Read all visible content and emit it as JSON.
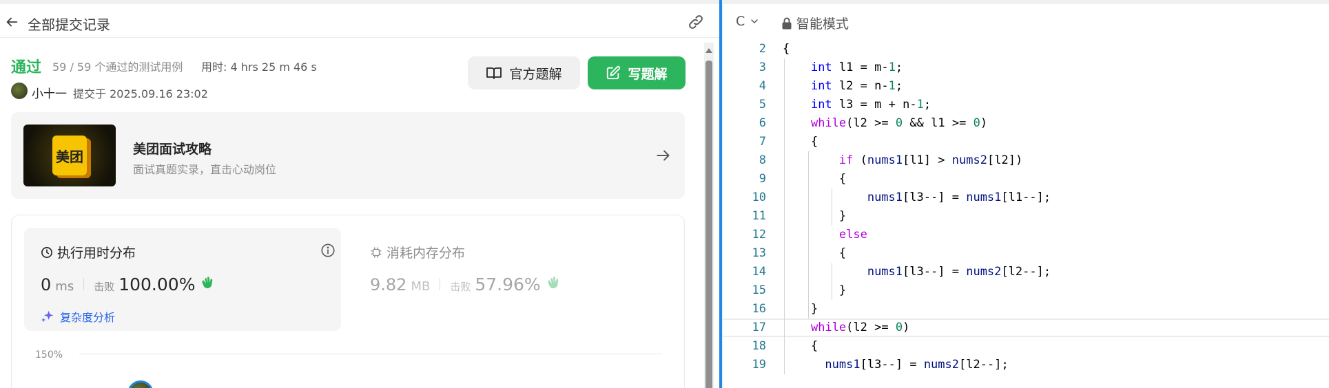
{
  "left_header": {
    "title": "全部提交记录"
  },
  "submission": {
    "status": "通过",
    "cases": "59 / 59 个通过的测试用例",
    "time_label": "用时: 4 hrs 25 m 46 s",
    "author": "小十一",
    "submitted_at": "提交于 2025.09.16 23:02"
  },
  "buttons": {
    "official": "官方题解",
    "write": "写题解"
  },
  "promo": {
    "logo_text": "美团",
    "title": "美团面试攻略",
    "subtitle": "面试真题实录，直击心动岗位"
  },
  "runtime": {
    "title": "执行用时分布",
    "value": "0",
    "unit": "ms",
    "beat_label": "击败",
    "beat_pct": "100.00%",
    "analysis": "复杂度分析"
  },
  "memory": {
    "title": "消耗内存分布",
    "value": "9.82",
    "unit": "MB",
    "beat_label": "击败",
    "beat_pct": "57.96%"
  },
  "chart": {
    "y_tick": "150%"
  },
  "editor_header": {
    "language": "C",
    "mode": "智能模式"
  },
  "code": {
    "current_line": "17",
    "lines": [
      {
        "n": "2",
        "text": "{"
      },
      {
        "n": "3",
        "text": "    int l1 = m-1;"
      },
      {
        "n": "4",
        "text": "    int l2 = n-1;"
      },
      {
        "n": "5",
        "text": "    int l3 = m + n-1;"
      },
      {
        "n": "6",
        "text": "    while(l2 >= 0 && l1 >= 0)"
      },
      {
        "n": "7",
        "text": "    {"
      },
      {
        "n": "8",
        "text": "        if (nums1[l1] > nums2[l2])"
      },
      {
        "n": "9",
        "text": "        {"
      },
      {
        "n": "10",
        "text": "            nums1[l3--] = nums1[l1--];"
      },
      {
        "n": "11",
        "text": "        }"
      },
      {
        "n": "12",
        "text": "        else"
      },
      {
        "n": "13",
        "text": "        {"
      },
      {
        "n": "14",
        "text": "            nums1[l3--] = nums2[l2--];"
      },
      {
        "n": "15",
        "text": "        }"
      },
      {
        "n": "16",
        "text": "    }"
      },
      {
        "n": "17",
        "text": "    while(l2 >= 0)"
      },
      {
        "n": "18",
        "text": "    {"
      },
      {
        "n": "19",
        "text": "      nums1[l3--] = nums2[l2--];"
      }
    ]
  },
  "colors": {
    "accent_green": "#2db55d",
    "link_blue": "#2463eb",
    "divider_blue": "#1e88e5"
  }
}
